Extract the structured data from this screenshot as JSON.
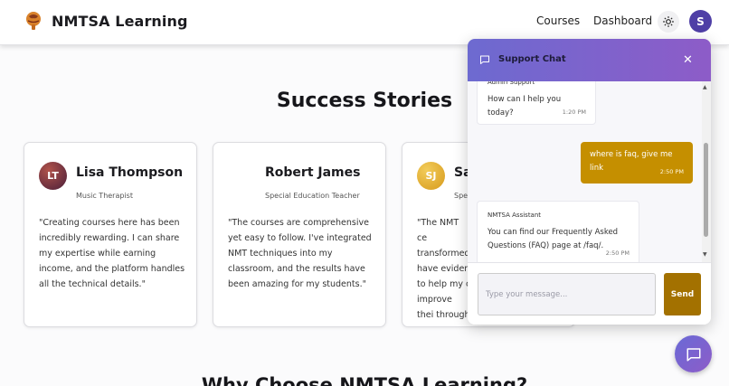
{
  "nav": {
    "brand": "NMTSA Learning",
    "links": [
      "Courses",
      "Dashboard"
    ],
    "avatar_initial": "S",
    "logo_icon": "brain-icon",
    "settings_icon": "gear-icon"
  },
  "success": {
    "title": "Success Stories",
    "cards": [
      {
        "initials": "LT",
        "name": "Lisa Thompson",
        "role": "Music Therapist",
        "quote": "\"Creating courses here has been incredibly rewarding. I can share my expertise while earning income, and the platform handles all the technical details.\"",
        "avatar_color": "#7a2c2f"
      },
      {
        "initials": "",
        "name": "Robert James",
        "role": "Special Education Teacher",
        "quote": "\"The courses are comprehensive yet easy to follow. I've integrated NMT techniques into my classroom, and the results have been amazing for my students.\""
      },
      {
        "initials": "SJ",
        "name": "Sa",
        "role": "Spe",
        "quote": "\"The NMT ce transformed have eviden to help my c improve thei through mus",
        "avatar_color": "#e2b43a"
      }
    ]
  },
  "why": {
    "title": "Why Choose NMTSA Learning?"
  },
  "chat": {
    "title": "Support Chat",
    "close_label": "✕",
    "messages": [
      {
        "sender": "Admin Support",
        "text": "How can I help you today?",
        "time": "1:20 PM",
        "from": "bot"
      },
      {
        "text": "where is faq, give me link",
        "time": "2:50 PM",
        "from": "user"
      },
      {
        "sender": "NMTSA Assistant",
        "text": "You can find our Frequently Asked Questions (FAQ) page at /faq/.",
        "time": "2:50 PM",
        "from": "bot"
      }
    ],
    "input_placeholder": "Type your message...",
    "send_label": "Send",
    "header_icon": "chat-bubble-icon",
    "fab_icon": "chat-bubble-icon"
  }
}
